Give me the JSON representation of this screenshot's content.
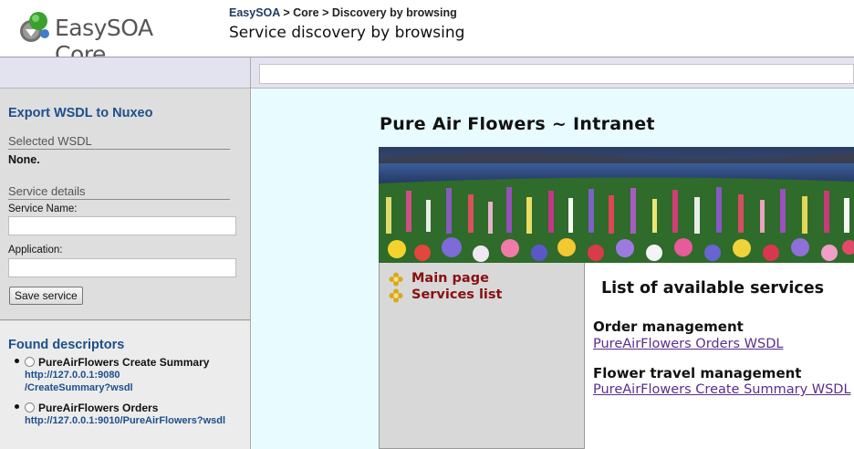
{
  "header": {
    "logo_text": "EasySOA Core",
    "breadcrumb": [
      {
        "label": "EasySOA"
      },
      {
        "label": "Core"
      },
      {
        "label": "Discovery by browsing"
      }
    ],
    "breadcrumb_separator": ">",
    "page_title": "Service discovery by browsing"
  },
  "toolbar": {
    "url_value": ""
  },
  "sidebar": {
    "export": {
      "heading": "Export WSDL to Nuxeo",
      "selected_wsdl_label": "Selected WSDL",
      "selected_wsdl_value": "None.",
      "service_details_label": "Service details",
      "service_name_label": "Service Name:",
      "service_name_value": "",
      "application_label": "Application:",
      "application_value": "",
      "save_button": "Save service"
    },
    "descriptors": {
      "heading": "Found descriptors",
      "items": [
        {
          "name": "PureAirFlowers Create Summary",
          "url_line1": "http://127.0.0.1:9080",
          "url_line2": "/CreateSummary?wsdl"
        },
        {
          "name": "PureAirFlowers Orders",
          "url_line1": "http://127.0.0.1:9010/PureAirFlowers?wsdl",
          "url_line2": ""
        }
      ]
    }
  },
  "site": {
    "title": "Pure Air Flowers ~ Intranet",
    "nav": [
      {
        "label": "Main page"
      },
      {
        "label": "Services list"
      }
    ],
    "services_heading": "List of available services",
    "services": [
      {
        "name": "Order management",
        "link": "PureAirFlowers Orders WSDL"
      },
      {
        "name": "Flower travel management",
        "link": "PureAirFlowers Create Summary WSDL"
      }
    ]
  },
  "colors": {
    "link_blue": "#1d4f8c",
    "nav_red": "#8a1010",
    "visited_link": "#5b2d8e",
    "content_bg": "#e8fbff",
    "sidebar_bg": "#dedede"
  },
  "icons": {
    "logo": "easysoa-logo-icon",
    "nav_bullet": "flower-icon"
  }
}
